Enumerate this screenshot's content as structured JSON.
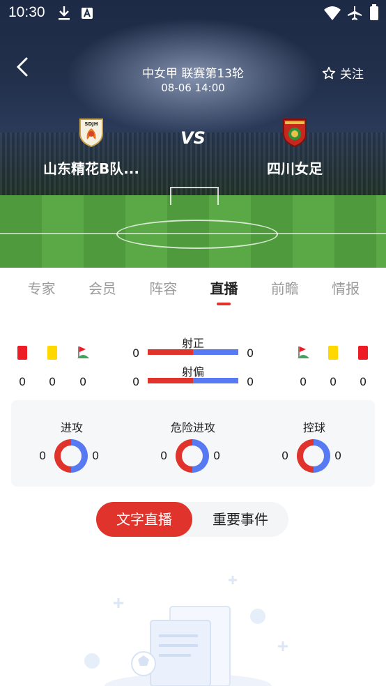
{
  "status_bar": {
    "time": "10:30",
    "icons": [
      "download-icon",
      "a-badge-icon",
      "wifi-icon",
      "airplane-icon",
      "battery-icon"
    ]
  },
  "header": {
    "league": "中女甲 联赛第13轮",
    "datetime": "08-06 14:00",
    "follow_label": "关注",
    "vs": "VS",
    "home_team": {
      "name": "山东精花B队...",
      "logo_text": "SDJH"
    },
    "away_team": {
      "name": "四川女足"
    }
  },
  "tabs": [
    {
      "label": "专家",
      "active": false
    },
    {
      "label": "会员",
      "active": false
    },
    {
      "label": "阵容",
      "active": false
    },
    {
      "label": "直播",
      "active": true
    },
    {
      "label": "前瞻",
      "active": false
    },
    {
      "label": "情报",
      "active": false
    }
  ],
  "stats": {
    "home_cards": {
      "red": "0",
      "yellow": "0",
      "corners": "0"
    },
    "away_cards": {
      "red": "0",
      "yellow": "0",
      "corners": "0"
    },
    "shots_on": {
      "label": "射正",
      "home": "0",
      "away": "0"
    },
    "shots_off": {
      "label": "射偏",
      "home": "0",
      "away": "0"
    }
  },
  "gauges": [
    {
      "title": "进攻",
      "home": "0",
      "away": "0"
    },
    {
      "title": "危险进攻",
      "home": "0",
      "away": "0"
    },
    {
      "title": "控球",
      "home": "0",
      "away": "0"
    }
  ],
  "segment": {
    "left": "文字直播",
    "right": "重要事件"
  },
  "colors": {
    "accent": "#e0332b",
    "blue": "#5779f2",
    "red_card": "#ee1c25",
    "yellow_card": "#ffd800"
  }
}
